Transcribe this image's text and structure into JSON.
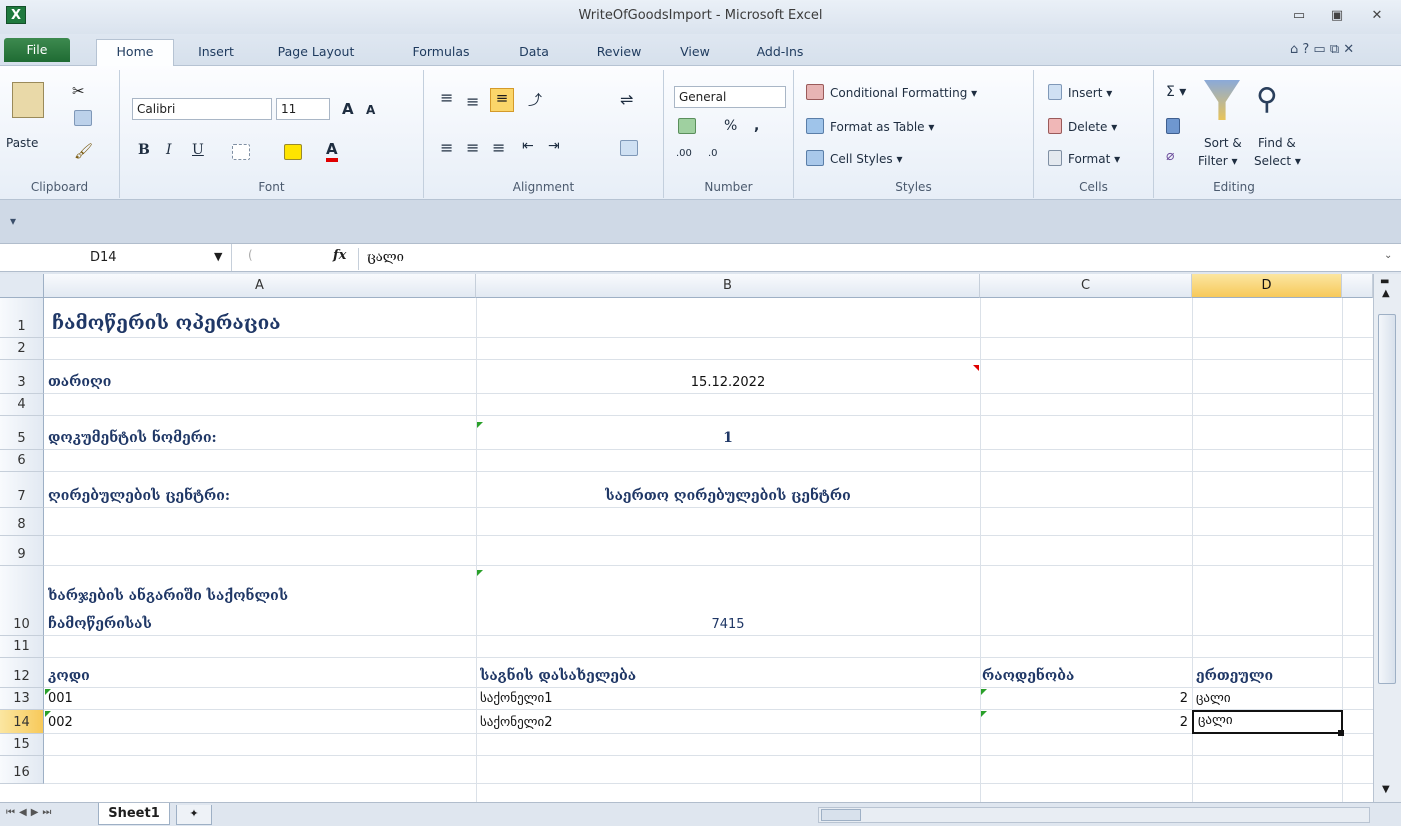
{
  "window": {
    "title": "WriteOfGoodsImport - Microsoft Excel",
    "app_icon": "X",
    "minimize": "▭",
    "restore": "▣",
    "close": "✕"
  },
  "ribbon_tabs": [
    "File",
    "Home",
    "Insert",
    "Page Layout",
    "Formulas",
    "Data",
    "Review",
    "View",
    "Add-Ins"
  ],
  "help_controls": "⌂ ? ▭ ⧉ ✕",
  "ribbon": {
    "clipboard": {
      "paste": "Paste",
      "label": "Clipboard"
    },
    "font": {
      "name": "Calibri",
      "size": "11",
      "bold": "B",
      "italic": "I",
      "underline": "U",
      "grow": "A",
      "shrink": "A",
      "font_color": "A",
      "label": "Font"
    },
    "alignment": {
      "label": "Alignment"
    },
    "number": {
      "format": "General",
      "percent": "%",
      "comma": ",",
      "inc": ".00",
      "dec": ".0",
      "label": "Number"
    },
    "styles": {
      "conditional": "Conditional Formatting ▾",
      "table": "Format as Table ▾",
      "cell": "Cell Styles ▾",
      "label": "Styles"
    },
    "cells": {
      "insert": "Insert ▾",
      "delete": "Delete ▾",
      "format": "Format ▾",
      "label": "Cells"
    },
    "editing": {
      "sum": "Σ ▾",
      "sort": "Sort &\nFilter ▾",
      "sort_line1": "Sort &",
      "sort_line2": "Filter ▾",
      "find_line1": "Find &",
      "find_line2": "Select ▾",
      "label": "Editing"
    }
  },
  "formula_bar": {
    "cell_ref": "D14",
    "fx": "fx",
    "content": "ცალი"
  },
  "columns": [
    "A",
    "B",
    "C",
    "D"
  ],
  "rows": [
    "1",
    "2",
    "3",
    "4",
    "5",
    "6",
    "7",
    "8",
    "9",
    "10",
    "11",
    "12",
    "13",
    "14",
    "15",
    "16"
  ],
  "cells": {
    "A1": "ჩამოწერის ოპერაცია",
    "A3": "თარიღი",
    "B3": "15.12.2022",
    "A5": "დოკუმენტის ნომერი:",
    "B5": "1",
    "A7": "ღირებულების ცენტრი:",
    "B7": "საერთო ღირებულების ცენტრი",
    "A10_line1": "ხარჯების ანგარიში საქონლის",
    "A10_line2": "ჩამოწერისას",
    "B10": "7415",
    "A12": "კოდი",
    "B12": "საგნის დასახელება",
    "C12": "რაოდენობა",
    "D12": "ერთეული",
    "A13": "001",
    "B13": "საქონელი1",
    "C13": "2",
    "D13": "ცალი",
    "A14": "002",
    "B14": "საქონელი2",
    "C14": "2",
    "D14": "ცალი"
  },
  "sheet_tabs": [
    "Sheet1"
  ]
}
